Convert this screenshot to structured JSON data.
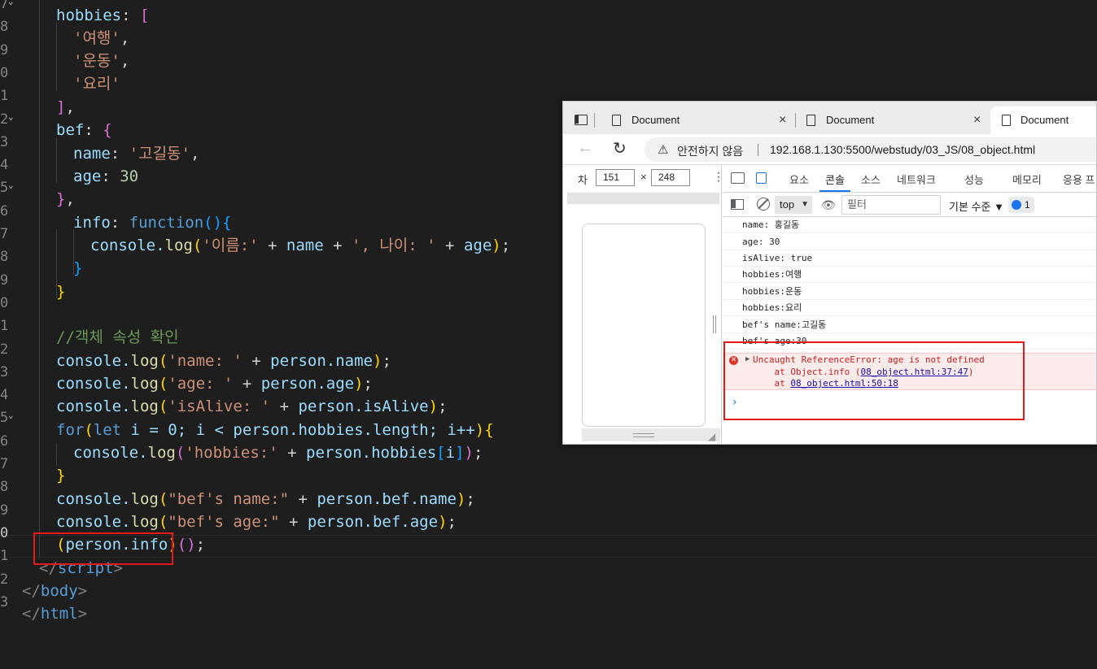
{
  "editor": {
    "line_numbers": [
      "7",
      "8",
      "9",
      "0",
      "1",
      "2",
      "3",
      "4",
      "5",
      "6",
      "7",
      "8",
      "9",
      "0",
      "1",
      "2",
      "3",
      "4",
      "5",
      "6",
      "7",
      "8",
      "9",
      "0",
      "1",
      "2",
      "3"
    ],
    "fold_marker": "⌄",
    "lines": {
      "hobbies_key": "hobbies",
      "hobbies_open": "[",
      "hobby_1": "'여행'",
      "hobby_2": "'운동'",
      "hobby_3": "'요리'",
      "hobbies_close": "]",
      "bef_key": "bef",
      "bef_open": "{",
      "name_key": "name",
      "name_val": "'고길동'",
      "age_key": "age",
      "age_val": "30",
      "bef_close": "}",
      "info_key": "info",
      "info_fn": "function",
      "info_body_a": "console.",
      "info_body_log": "log",
      "info_body_str1": "'이름:'",
      "info_body_plus1": " + ",
      "info_body_name": "name",
      "info_body_plus2": " + ",
      "info_body_str2": "', 나이: '",
      "info_body_plus3": " + ",
      "info_body_age": "age",
      "comment": "//객체 속성 확인",
      "log_name_str": "'name: '",
      "log_name_expr": "person.name",
      "log_age_str": "'age: '",
      "log_age_expr": "person.age",
      "log_alive_str": "'isAlive: '",
      "log_alive_expr": "person.isAlive",
      "for_kw": "for",
      "for_let": "let",
      "for_body": " i = 0; i < person.hobbies.length; i++",
      "for_log_str": "'hobbies:'",
      "for_log_expr": "person.hobbies",
      "for_log_idx": "i",
      "log_befname_str": "\"bef's name:\"",
      "log_befname_expr": "person.bef.name",
      "log_befage_str": "\"bef's age:\"",
      "log_befage_expr": "person.bef.age",
      "call_expr": "person.info",
      "script_close": "script",
      "body_close": "body",
      "html_close": "html"
    }
  },
  "browser": {
    "tabs": [
      {
        "title": "Document",
        "close": "×"
      },
      {
        "title": "Document",
        "close": "×"
      },
      {
        "title": "Document"
      }
    ],
    "security_text": "안전하지 않음",
    "url": "192.168.1.130:5500/webstudy/03_JS/08_object.html",
    "device": {
      "dim_label": "차",
      "width": "151",
      "height": "248",
      "x": "×"
    },
    "devtools": {
      "tabs": [
        "요소",
        "콘솔",
        "소스",
        "네트워크",
        "성능",
        "메모리",
        "응용 프"
      ],
      "active_tab": "콘솔",
      "context": "top",
      "filter_placeholder": "필터",
      "levels": "기본 수준 ▼",
      "issues_count": "1"
    },
    "console": {
      "logs": [
        "name: 홍길동",
        "age: 30",
        "isAlive: true",
        "hobbies:여행",
        "hobbies:운동",
        "hobbies:요리",
        "bef's name:고길동",
        "bef's age:30"
      ],
      "error": {
        "message": "Uncaught ReferenceError: age is not defined",
        "frame1_prefix": "    at Object.info (",
        "frame1_link": "08_object.html:37:47",
        "frame1_suffix": ")",
        "frame2_prefix": "    at ",
        "frame2_link": "08_object.html:50:18"
      },
      "prompt": "›"
    }
  },
  "colors": {
    "annotation_red": "#e51919",
    "editor_bg": "#1e1e1e",
    "accent_blue": "#1a73e8"
  }
}
